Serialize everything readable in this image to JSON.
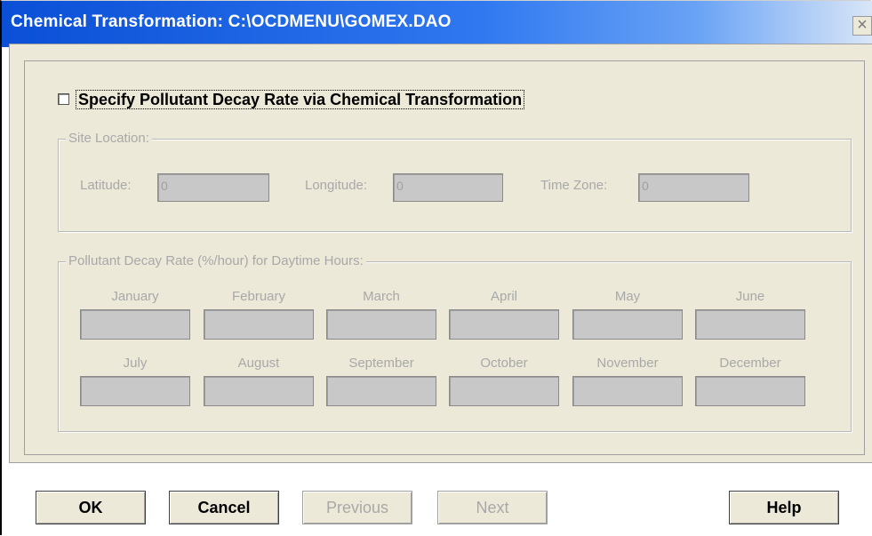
{
  "window": {
    "title": "Chemical Transformation: C:\\OCDMENU\\GOMEX.DAO",
    "close_glyph": "×"
  },
  "checkbox": {
    "label": "Specify Pollutant Decay Rate via Chemical Transformation",
    "checked": false
  },
  "site_location": {
    "title": "Site Location:",
    "latitude_label": "Latitude:",
    "latitude_value": "0",
    "longitude_label": "Longitude:",
    "longitude_value": "0",
    "timezone_label": "Time Zone:",
    "timezone_value": "0"
  },
  "decay_rate": {
    "title": "Pollutant Decay Rate (%/hour) for Daytime Hours:",
    "months": [
      "January",
      "February",
      "March",
      "April",
      "May",
      "June",
      "July",
      "August",
      "September",
      "October",
      "November",
      "December"
    ]
  },
  "buttons": {
    "ok": "OK",
    "cancel": "Cancel",
    "previous": "Previous",
    "next": "Next",
    "help": "Help"
  }
}
